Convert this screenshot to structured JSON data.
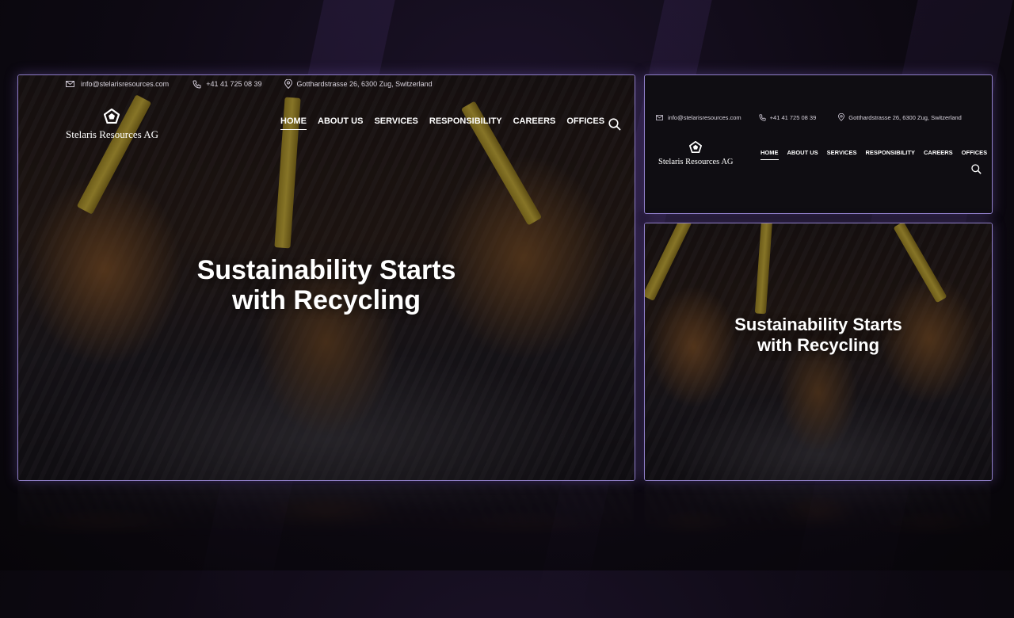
{
  "site": {
    "brand": "Stelaris Resources AG",
    "contact": {
      "email": "info@stelarisresources.com",
      "phone": "+41 41 725 08 39",
      "address": "Gotthardstrasse 26, 6300 Zug, Switzerland"
    },
    "nav": [
      "HOME",
      "ABOUT US",
      "SERVICES",
      "RESPONSIBILITY",
      "CAREERS",
      "OFFICES"
    ],
    "active_nav": "HOME",
    "hero": {
      "line1": "Sustainability Starts",
      "line2": "with Recycling"
    }
  },
  "icons": {
    "email": "mail-icon",
    "phone": "phone-icon",
    "address": "map-pin-icon",
    "search": "search-icon",
    "logo": "pentagon-logo-icon"
  },
  "colors": {
    "accent_border": "#8f7fc8",
    "backdrop": "#0d0912",
    "header_dark": "#0f0d12",
    "arm_yellow": "#d6ba33"
  }
}
